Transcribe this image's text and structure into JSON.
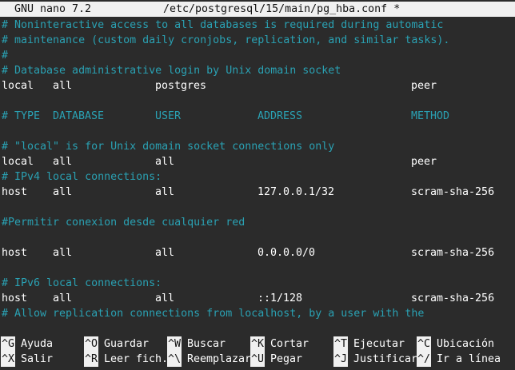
{
  "titlebar": {
    "app": "GNU nano 7.2",
    "file": "/etc/postgresql/15/main/pg_hba.conf *"
  },
  "lines": [
    {
      "type": "comment",
      "text": "# Noninteractive access to all databases is required during automatic"
    },
    {
      "type": "comment",
      "text": "# maintenance (custom daily cronjobs, replication, and similar tasks)."
    },
    {
      "type": "comment",
      "text": "#"
    },
    {
      "type": "comment",
      "text": "# Database administrative login by Unix domain socket"
    },
    {
      "type": "entry",
      "cols": [
        "local",
        "all",
        "postgres",
        "",
        "peer"
      ]
    },
    {
      "type": "blank"
    },
    {
      "type": "header",
      "cols": [
        "# TYPE",
        "DATABASE",
        "USER",
        "ADDRESS",
        "METHOD"
      ]
    },
    {
      "type": "blank"
    },
    {
      "type": "comment",
      "text": "# \"local\" is for Unix domain socket connections only"
    },
    {
      "type": "entry",
      "cols": [
        "local",
        "all",
        "all",
        "",
        "peer"
      ]
    },
    {
      "type": "comment",
      "text": "# IPv4 local connections:"
    },
    {
      "type": "entry",
      "cols": [
        "host",
        "all",
        "all",
        "127.0.0.1/32",
        "scram-sha-256"
      ]
    },
    {
      "type": "blank"
    },
    {
      "type": "comment",
      "text": "#Permitir conexion desde cualquier red"
    },
    {
      "type": "blank"
    },
    {
      "type": "entry",
      "cols": [
        "host",
        "all",
        "all",
        "0.0.0.0/0",
        "scram-sha-256"
      ]
    },
    {
      "type": "blank"
    },
    {
      "type": "comment",
      "text": "# IPv6 local connections:"
    },
    {
      "type": "entry",
      "cols": [
        "host",
        "all",
        "all",
        "::1/128",
        "scram-sha-256"
      ]
    },
    {
      "type": "comment",
      "text": "# Allow replication connections from localhost, by a user with the"
    }
  ],
  "shortcuts": [
    [
      {
        "key": "^G",
        "label": "Ayuda"
      },
      {
        "key": "^O",
        "label": "Guardar"
      },
      {
        "key": "^W",
        "label": "Buscar"
      },
      {
        "key": "^K",
        "label": "Cortar"
      },
      {
        "key": "^T",
        "label": "Ejecutar"
      },
      {
        "key": "^C",
        "label": "Ubicación"
      }
    ],
    [
      {
        "key": "^X",
        "label": "Salir"
      },
      {
        "key": "^R",
        "label": "Leer fich."
      },
      {
        "key": "^\\",
        "label": "Reemplazar"
      },
      {
        "key": "^U",
        "label": "Pegar"
      },
      {
        "key": "^J",
        "label": "Justificar"
      },
      {
        "key": "^/",
        "label": "Ir a línea"
      }
    ]
  ],
  "colors": {
    "background": "#2b2b2b",
    "comment": "#2aa1b3",
    "text": "#ffffff",
    "bar": "#f0f0f0"
  }
}
